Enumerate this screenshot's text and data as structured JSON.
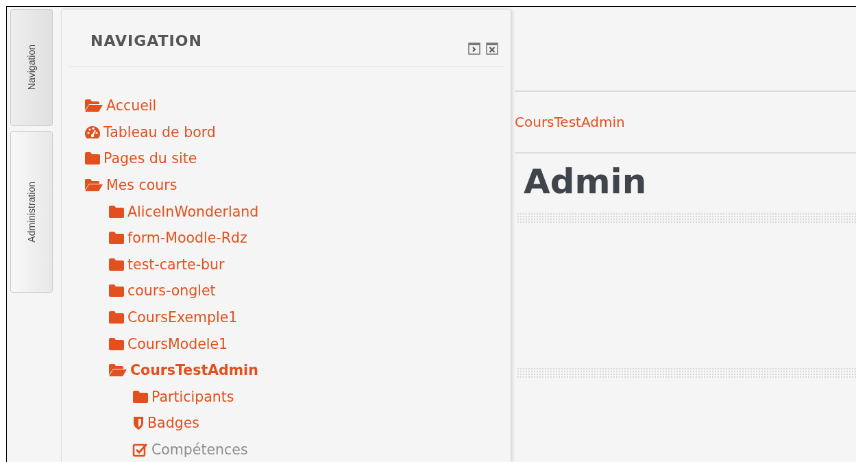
{
  "side_tabs": [
    {
      "label": "Navigation",
      "selected": true
    },
    {
      "label": "Administration",
      "selected": false
    }
  ],
  "navigation_block": {
    "title": "NAVIGATION",
    "items": [
      {
        "label": "Accueil",
        "kind": "folder-open",
        "bold": false,
        "link": true
      },
      {
        "label": "Tableau de bord",
        "kind": "dashboard",
        "bold": false,
        "link": true
      },
      {
        "label": "Pages du site",
        "kind": "folder",
        "bold": false,
        "link": true
      },
      {
        "label": "Mes cours",
        "kind": "folder-open",
        "bold": false,
        "link": true,
        "children": [
          {
            "label": "AliceInWonderland",
            "kind": "folder",
            "bold": false,
            "link": true
          },
          {
            "label": "form-Moodle-Rdz",
            "kind": "folder",
            "bold": false,
            "link": true
          },
          {
            "label": "test-carte-bur",
            "kind": "folder",
            "bold": false,
            "link": true
          },
          {
            "label": "cours-onglet",
            "kind": "folder",
            "bold": false,
            "link": true
          },
          {
            "label": "CoursExemple1",
            "kind": "folder",
            "bold": false,
            "link": true
          },
          {
            "label": "CoursModele1",
            "kind": "folder",
            "bold": false,
            "link": true
          },
          {
            "label": "CoursTestAdmin",
            "kind": "folder-open",
            "bold": true,
            "link": true,
            "children": [
              {
                "label": "Participants",
                "kind": "folder",
                "bold": false,
                "link": true
              },
              {
                "label": "Badges",
                "kind": "shield",
                "bold": false,
                "link": true
              },
              {
                "label": "Compétences",
                "kind": "checkbox",
                "bold": false,
                "link": false
              }
            ]
          }
        ]
      }
    ]
  },
  "breadcrumb": "CoursTestAdmin",
  "page_heading": "Admin"
}
